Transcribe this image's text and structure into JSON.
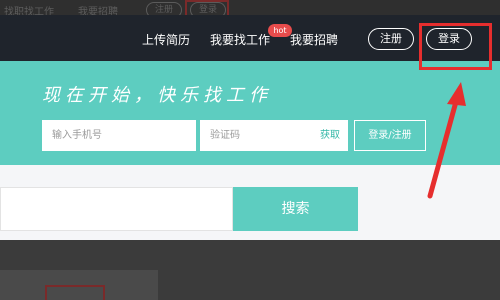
{
  "background_strip": {
    "find_job": "找职找工作",
    "post_job": "我要招聘",
    "register": "注册",
    "login": "登录"
  },
  "topbar": {
    "upload_resume": "上传简历",
    "find_job": "我要找工作",
    "hot_badge": "hot",
    "post_job": "我要招聘",
    "register": "注册",
    "login": "登录"
  },
  "hero": {
    "slogan": "现在开始，快乐找工作",
    "phone_placeholder": "输入手机号",
    "code_placeholder": "验证码",
    "get_code": "获取",
    "login_register": "登录/注册"
  },
  "search": {
    "button_label": "搜索",
    "input_value": ""
  },
  "colors": {
    "accent": "#5dcdc0",
    "topbar": "#1f242c",
    "highlight": "#e62e2e",
    "hot": "#e84c4c"
  }
}
